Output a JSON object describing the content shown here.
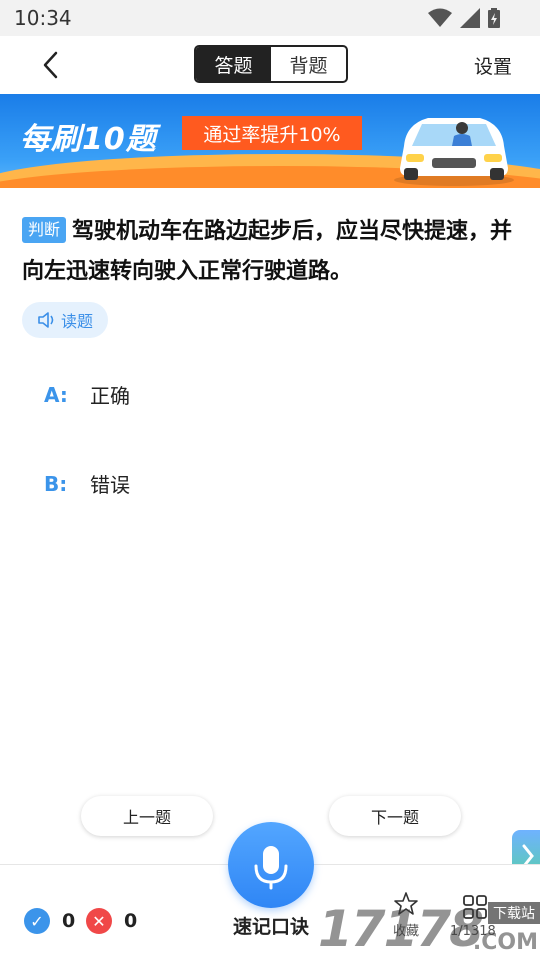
{
  "status": {
    "time": "10:34"
  },
  "nav": {
    "tabs": [
      {
        "label": "答题",
        "active": true
      },
      {
        "label": "背题",
        "active": false
      }
    ],
    "settings_label": "设置"
  },
  "banner": {
    "title": "每刷10题",
    "badge": "通过率提升10%"
  },
  "question": {
    "tag": "判断",
    "text": "驾驶机动车在路边起步后，应当尽快提速，并向左迅速转向驶入正常行驶道路。",
    "read_label": "读题",
    "options": [
      {
        "key": "A:",
        "text": "正确"
      },
      {
        "key": "B:",
        "text": "错误"
      }
    ]
  },
  "controls": {
    "prev_label": "上一题",
    "next_label": "下一题"
  },
  "bottom": {
    "correct_count": "0",
    "wrong_count": "0",
    "mic_label": "速记口诀",
    "favorite_label": "收藏",
    "progress": "1/1318"
  },
  "watermark": {
    "digits": "17178",
    "sub": "下载站",
    "domain": ".COM"
  },
  "colors": {
    "accent": "#3b94ea",
    "correct": "#3b94ea",
    "wrong": "#f04848",
    "badge": "#ff5a1f"
  },
  "icons": [
    "wifi-icon",
    "signal-icon",
    "battery-icon",
    "back-icon",
    "speaker-icon",
    "mic-icon",
    "check-icon",
    "cross-icon",
    "star-icon",
    "grid-icon"
  ]
}
